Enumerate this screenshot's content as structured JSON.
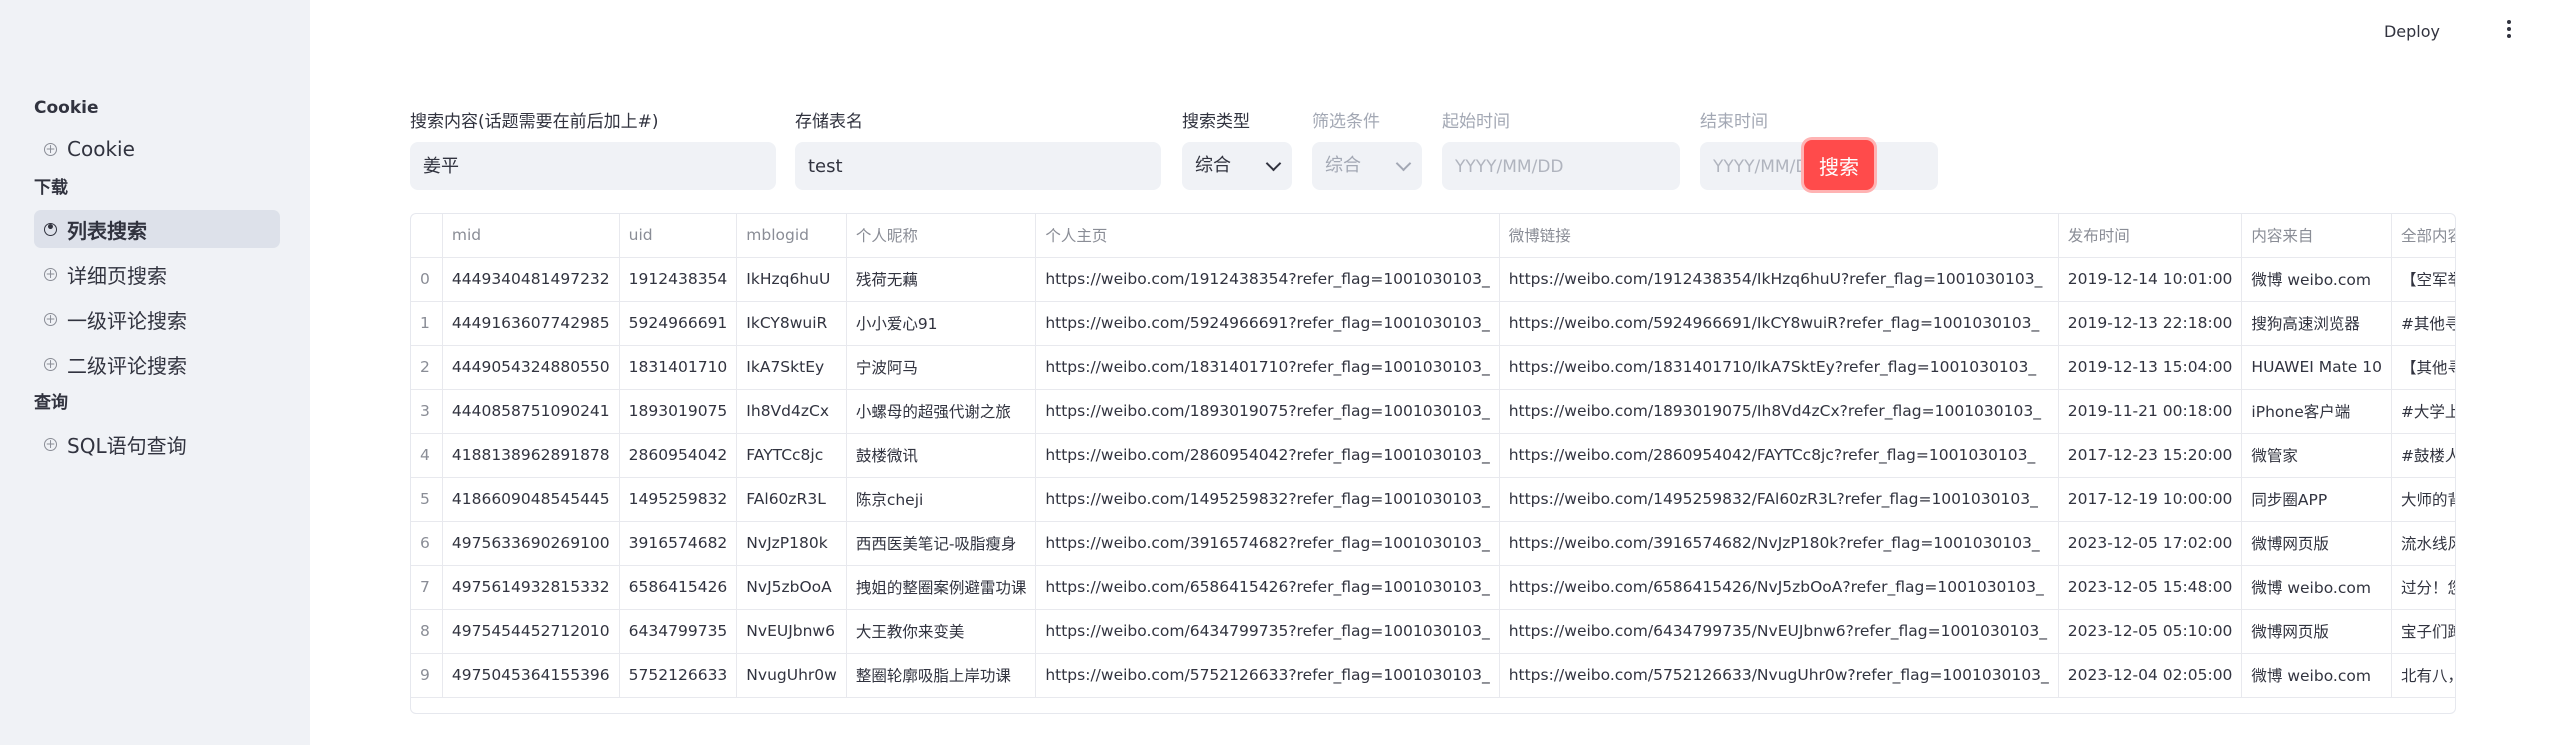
{
  "sidebar": {
    "sections": [
      {
        "title": "Cookie",
        "items": [
          {
            "label": "Cookie",
            "active": false
          }
        ]
      },
      {
        "title": "下载",
        "items": [
          {
            "label": "列表搜索",
            "active": true
          },
          {
            "label": "详细页搜索",
            "active": false
          },
          {
            "label": "一级评论搜索",
            "active": false
          },
          {
            "label": "二级评论搜索",
            "active": false
          }
        ]
      },
      {
        "title": "查询",
        "items": [
          {
            "label": "SQL语句查询",
            "active": false
          }
        ]
      }
    ]
  },
  "topbar": {
    "deploy_label": "Deploy"
  },
  "form": {
    "search_content": {
      "label": "搜索内容(话题需要在前后加上#)",
      "value": "姜平"
    },
    "table_name": {
      "label": "存储表名",
      "value": "test"
    },
    "search_type": {
      "label": "搜索类型",
      "value": "综合"
    },
    "filter": {
      "label": "筛选条件",
      "value": "综合"
    },
    "start_time": {
      "label": "起始时间",
      "placeholder": "YYYY/MM/DD"
    },
    "end_time": {
      "label": "结束时间",
      "placeholder": "YYYY/MM/DD"
    },
    "search_button": "搜索"
  },
  "table": {
    "columns": [
      "",
      "mid",
      "uid",
      "mblogid",
      "个人昵称",
      "个人主页",
      "微博链接",
      "发布时间",
      "内容来自",
      "全部内容"
    ],
    "rows": [
      [
        "0",
        "4449340481497232",
        "1912438354",
        "IkHzq6huU",
        "残荷无藕",
        "https://weibo.com/1912438354?refer_flag=1001030103_",
        "https://weibo.com/1912438354/IkHzq6huU?refer_flag=1001030103_",
        "2019-12-14 10:01:00",
        "微博 weibo.com",
        "【空军举行将官"
      ],
      [
        "1",
        "4449163607742985",
        "5924966691",
        "IkCY8wuiR",
        "小小爱心91",
        "https://weibo.com/5924966691?refer_flag=1001030103_",
        "https://weibo.com/5924966691/IkCY8wuiR?refer_flag=1001030103_",
        "2019-12-13 22:18:00",
        "搜狗高速浏览器",
        "#其他寻人# 寻"
      ],
      [
        "2",
        "4449054324880550",
        "1831401710",
        "IkA7SktEy",
        "宁波阿马",
        "https://weibo.com/1831401710?refer_flag=1001030103_",
        "https://weibo.com/1831401710/IkA7SktEy?refer_flag=1001030103_",
        "2019-12-13 15:04:00",
        "HUAWEI Mate 10",
        "【其他寻人求助"
      ],
      [
        "3",
        "4440858751090241",
        "1893019075",
        "Ih8Vd4zCx",
        "小螺母的超强代谢之旅",
        "https://weibo.com/1893019075?refer_flag=1001030103_",
        "https://weibo.com/1893019075/Ih8Vd4zCx?refer_flag=1001030103_",
        "2019-11-21 00:18:00",
        "iPhone客户端",
        "#大学上体育课"
      ],
      [
        "4",
        "4188138962891878",
        "2860954042",
        "FAYTCc8jc",
        "鼓楼微讯",
        "https://weibo.com/2860954042?refer_flag=1001030103_",
        "https://weibo.com/2860954042/FAYTCc8jc?refer_flag=1001030103_",
        "2017-12-23 15:20:00",
        "微管家",
        "#鼓楼人物#【律"
      ],
      [
        "5",
        "4186609048545445",
        "1495259832",
        "FAl60zR3L",
        "陈京cheji",
        "https://weibo.com/1495259832?refer_flag=1001030103_",
        "https://weibo.com/1495259832/FAl60zR3L?refer_flag=1001030103_",
        "2017-12-19 10:00:00",
        "同步圈APP",
        "大师的背影…三"
      ],
      [
        "6",
        "4975633690269100",
        "3916574682",
        "NvJzP180k",
        "西西医美笔记-吸脂瘦身",
        "https://weibo.com/3916574682?refer_flag=1001030103_",
        "https://weibo.com/3916574682/NvJzP180k?refer_flag=1001030103_",
        "2023-12-05 17:02:00",
        "微博网页版",
        "流水线风格的ソ"
      ],
      [
        "7",
        "4975614932815332",
        "6586415426",
        "NvJ5zbOoA",
        "拽姐的整圈案例避雷功课",
        "https://weibo.com/6586415426?refer_flag=1001030103_",
        "https://weibo.com/6586415426/NvJ5zbOoA?refer_flag=1001030103_",
        "2023-12-05 15:48:00",
        "微博 weibo.com",
        "过分！您这人~"
      ],
      [
        "8",
        "4975454452712010",
        "6434799735",
        "NvEUJbnw6",
        "大王教你来变美",
        "https://weibo.com/6434799735?refer_flag=1001030103_",
        "https://weibo.com/6434799735/NvEUJbnw6?refer_flag=1001030103_",
        "2023-12-05 05:10:00",
        "微博网页版",
        "宝子们蹲医森钰"
      ],
      [
        "9",
        "4975045364155396",
        "5752126633",
        "NvugUhr0w",
        "整圈轮廓吸脂上岸功课",
        "https://weibo.com/5752126633?refer_flag=1001030103_",
        "https://weibo.com/5752126633/NvugUhr0w?refer_flag=1001030103_",
        "2023-12-04 02:05:00",
        "微博 weibo.com",
        "北有八，南有ラ"
      ]
    ]
  },
  "colors": {
    "accent": "#ff4b4b",
    "sidebar_bg": "#f0f2f6",
    "input_bg": "#f0f2f6"
  }
}
